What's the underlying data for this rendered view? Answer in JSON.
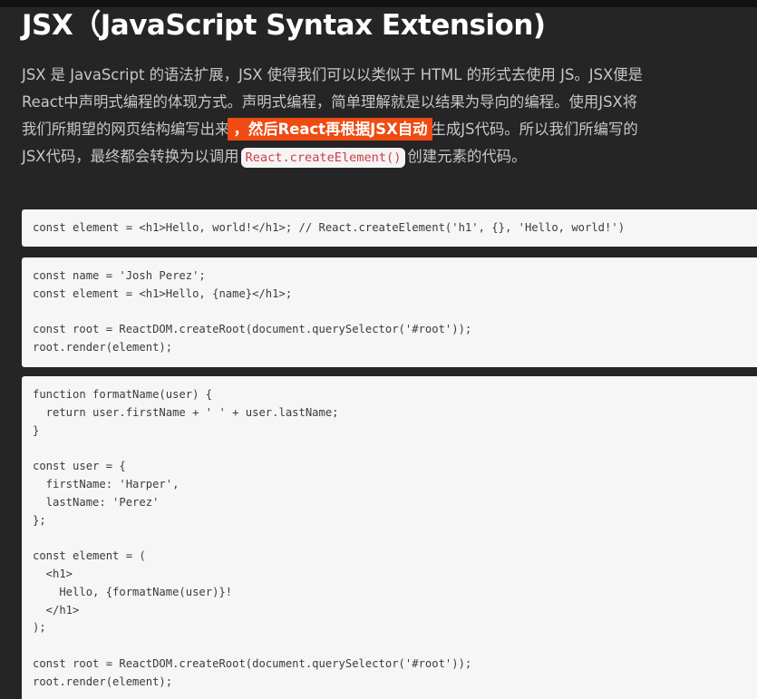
{
  "title": "JSX（JavaScript Syntax Extension)",
  "paragraph": {
    "line1": "JSX 是 JavaScript 的语法扩展，JSX 使得我们可以以类似于 HTML 的形式去使用 JS。JSX便是",
    "line2": "React中声明式编程的体现方式。声明式编程，简单理解就是以结果为导向的编程。使用JSX将",
    "line3_before": "我们所期望的网页结构编写出来",
    "line3_highlight": "，然后React再根据JSX自动",
    "line3_after": "生成JS代码。所以我们所编写的",
    "line4_before": "JSX代码，最终都会转换为以调用",
    "line4_code": "React.createElement()",
    "line4_after": "创建元素的代码。"
  },
  "code_blocks": [
    {
      "lines": [
        "const element = <h1>Hello, world!</h1>; // React.createElement('h1', {}, 'Hello, world!')"
      ]
    },
    {
      "lines": [
        "const name = 'Josh Perez';",
        "const element = <h1>Hello, {name}</h1>;",
        "",
        "const root = ReactDOM.createRoot(document.querySelector('#root'));",
        "root.render(element);"
      ]
    },
    {
      "lines": [
        "function formatName(user) {",
        "  return user.firstName + ' ' + user.lastName;",
        "}",
        "",
        "const user = {",
        "  firstName: 'Harper',",
        "  lastName: 'Perez'",
        "};",
        "",
        "const element = (",
        "  <h1>",
        "    Hello, {formatName(user)}!",
        "  </h1>",
        ");",
        "",
        "const root = ReactDOM.createRoot(document.querySelector('#root'));",
        "root.render(element);"
      ]
    }
  ],
  "colors": {
    "background": "#252526",
    "highlight": "#ef4b13",
    "code_background": "#f6f6f6",
    "inline_code_text": "#d03e43"
  }
}
